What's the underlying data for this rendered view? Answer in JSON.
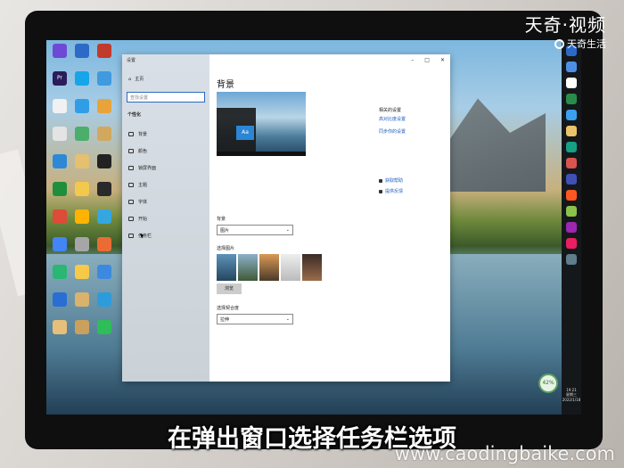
{
  "watermark": {
    "brand": "天奇·视频",
    "sub": "天奇生活"
  },
  "caption": "在弹出窗口选择任务栏选项",
  "url": "www.caodingbaike.com",
  "settings": {
    "title": "设置",
    "home": "主页",
    "search_placeholder": "查找设置",
    "section": "个性化",
    "nav_items": [
      "背景",
      "颜色",
      "锁屏界面",
      "主题",
      "字体",
      "开始",
      "任务栏"
    ],
    "page_title": "背景",
    "bg_label": "背景",
    "bg_value": "图片",
    "choose_label": "选择图片",
    "browse": "浏览",
    "fit_label": "选择契合度",
    "fit_value": "拉伸",
    "related_heading": "相关的设置",
    "related_links": [
      "高对比度设置",
      "同步你的设置"
    ],
    "help_links": [
      "获取帮助",
      "提供反馈"
    ],
    "preview_tile": "Aa"
  },
  "tray": {
    "time": "19:21",
    "day": "星期三",
    "date": "2022/1/18",
    "cpu": "42%"
  },
  "desktop_icons": [
    {
      "label": "",
      "color": "#6d4ad6"
    },
    {
      "label": "",
      "color": "#2d6ac7"
    },
    {
      "label": "",
      "color": "#c23a2c"
    },
    {
      "label": "Pr",
      "color": "#2a1d5c"
    },
    {
      "label": "",
      "color": "#16a5e8"
    },
    {
      "label": "",
      "color": "#3f9ae0"
    },
    {
      "label": "",
      "color": "#f1f1f1"
    },
    {
      "label": "",
      "color": "#2f9ee6"
    },
    {
      "label": "",
      "color": "#e8a33b"
    },
    {
      "label": "",
      "color": "#e4e4e4"
    },
    {
      "label": "",
      "color": "#4cae6b"
    },
    {
      "label": "",
      "color": "#d2a85e"
    },
    {
      "label": "",
      "color": "#2d89d6"
    },
    {
      "label": "",
      "color": "#e5c06f"
    },
    {
      "label": "",
      "color": "#222"
    },
    {
      "label": "",
      "color": "#1f8f3d"
    },
    {
      "label": "",
      "color": "#f2c94c"
    },
    {
      "label": "",
      "color": "#2a2a2a"
    },
    {
      "label": "",
      "color": "#dd4b39"
    },
    {
      "label": "",
      "color": "#ffb300"
    },
    {
      "label": "",
      "color": "#35a6e0"
    },
    {
      "label": "",
      "color": "#4285f4"
    },
    {
      "label": "",
      "color": "#a6a6a6"
    },
    {
      "label": "",
      "color": "#eb6b34"
    },
    {
      "label": "",
      "color": "#2ab673"
    },
    {
      "label": "",
      "color": "#f7c948"
    },
    {
      "label": "",
      "color": "#3c8adf"
    },
    {
      "label": "",
      "color": "#2a6dd3"
    },
    {
      "label": "",
      "color": "#d9b36b"
    },
    {
      "label": "",
      "color": "#2d9cdb"
    },
    {
      "label": "",
      "color": "#e6c07b"
    },
    {
      "label": "",
      "color": "#c9a15c"
    },
    {
      "label": "",
      "color": "#2ebd59"
    }
  ],
  "taskbar_icon_colors": [
    "#2d6ac7",
    "#4e8fe6",
    "#fff",
    "#2a8c4a",
    "#3aa0f0",
    "#e9c46a",
    "#16a085",
    "#d9534f",
    "#3f51b5",
    "#ff5722",
    "#8bc34a",
    "#9c27b0",
    "#e91e63",
    "#607d8b"
  ]
}
